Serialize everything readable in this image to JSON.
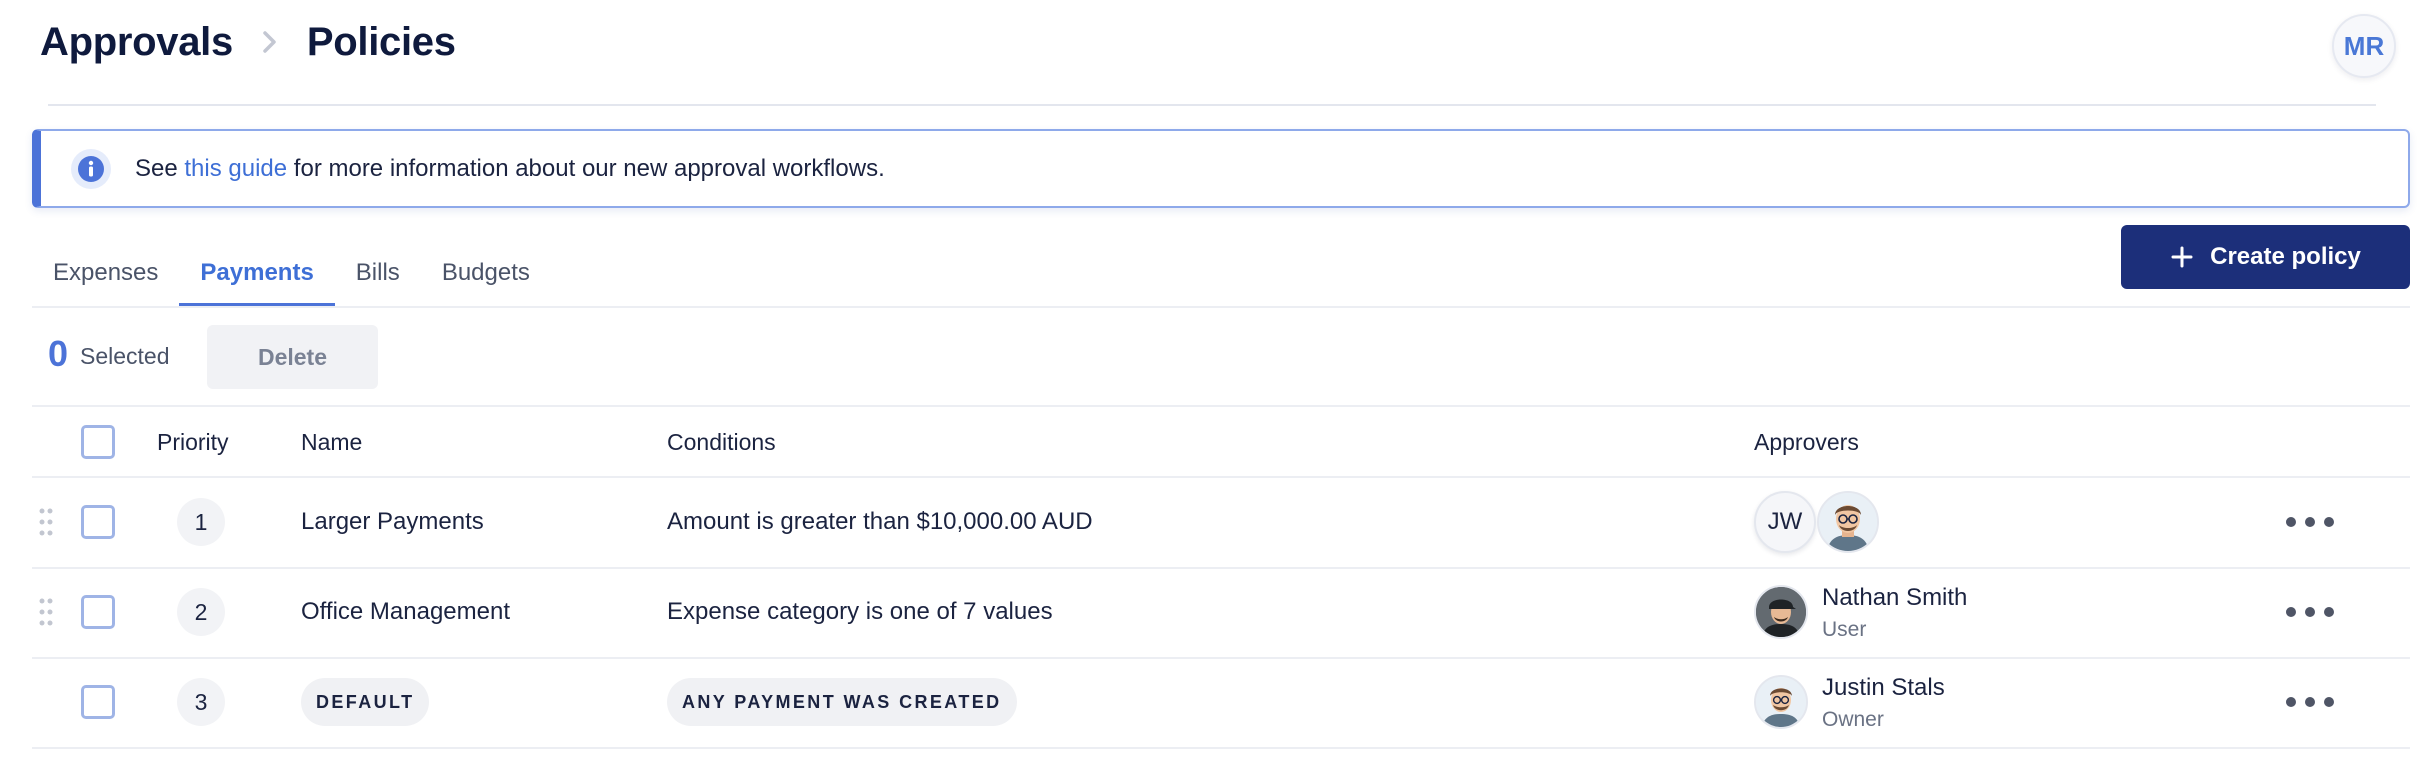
{
  "breadcrumb": {
    "parent": "Approvals",
    "current": "Policies"
  },
  "user": {
    "initials": "MR"
  },
  "banner": {
    "prefix": "See",
    "link_text": "this guide",
    "suffix": "for more information about our new approval workflows."
  },
  "tabs": [
    {
      "label": "Expenses",
      "active": false
    },
    {
      "label": "Payments",
      "active": true
    },
    {
      "label": "Bills",
      "active": false
    },
    {
      "label": "Budgets",
      "active": false
    }
  ],
  "create_button": {
    "label": "Create policy",
    "icon": "plus-icon"
  },
  "selection": {
    "count": "0",
    "label": "Selected",
    "delete_label": "Delete"
  },
  "table": {
    "columns": {
      "priority": "Priority",
      "name": "Name",
      "conditions": "Conditions",
      "approvers": "Approvers"
    },
    "rows": [
      {
        "priority": "1",
        "name": "Larger Payments",
        "condition": "Amount is greater than $10,000.00 AUD",
        "approvers": [
          {
            "initials": "JW"
          },
          {
            "avatar": "cartoon-avatar-glasses"
          }
        ]
      },
      {
        "priority": "2",
        "name": "Office Management",
        "condition": "Expense category is one of 7 values",
        "approvers": [
          {
            "name": "Nathan Smith",
            "role": "User",
            "avatar": "cartoon-avatar-cap"
          }
        ]
      },
      {
        "priority": "3",
        "name": "DEFAULT",
        "condition": "ANY PAYMENT WAS CREATED",
        "approvers": [
          {
            "name": "Justin Stals",
            "role": "Owner",
            "avatar": "cartoon-avatar-glasses"
          }
        ]
      }
    ]
  },
  "colors": {
    "accent": "#4c73d8",
    "primary_button": "#1c2f7a",
    "heading": "#0f1a3d"
  }
}
